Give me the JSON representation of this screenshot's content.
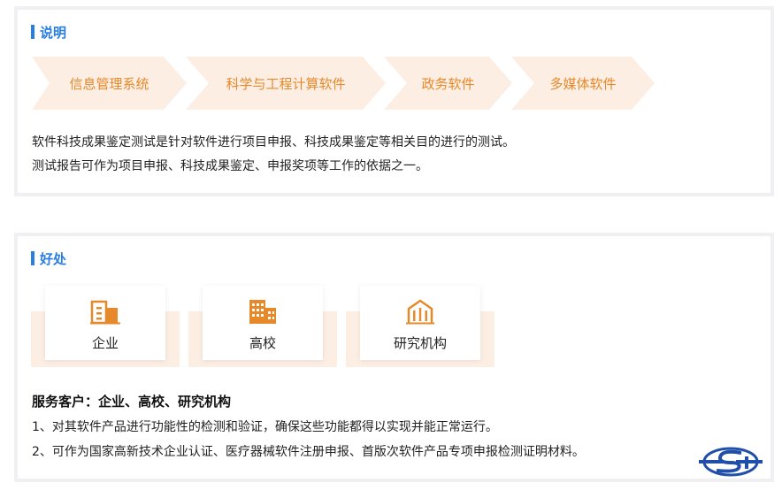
{
  "description": {
    "title": "说明",
    "categories": [
      "信息管理系统",
      "科学与工程计算软件",
      "政务软件",
      "多媒体软件"
    ],
    "lines": [
      "软件科技成果鉴定测试是针对软件进行项目申报、科技成果鉴定等相关目的进行的测试。",
      "测试报告可作为项目申报、科技成果鉴定、申报奖项等工作的依据之一。"
    ]
  },
  "benefits": {
    "title": "好处",
    "cards": [
      {
        "label": "企业",
        "icon": "company-building-icon"
      },
      {
        "label": "高校",
        "icon": "school-building-icon"
      },
      {
        "label": "研究机构",
        "icon": "research-institute-icon"
      }
    ],
    "clients_title": "服务客户：企业、高校、研究机构",
    "items": [
      "1、对其软件产品进行功能性的检测和验证，确保这些功能都得以实现并能正常运行。",
      "2、可作为国家高新技术企业认证、医疗器械软件注册申报、首版次软件产品专项申报检测证明材料。"
    ]
  },
  "colors": {
    "accent_blue": "#2a7de1",
    "orange": "#e6892b",
    "peach": "#fdeee3",
    "logo_blue": "#1f4fa8"
  },
  "logo": {
    "icon": "company-logo-icon"
  }
}
